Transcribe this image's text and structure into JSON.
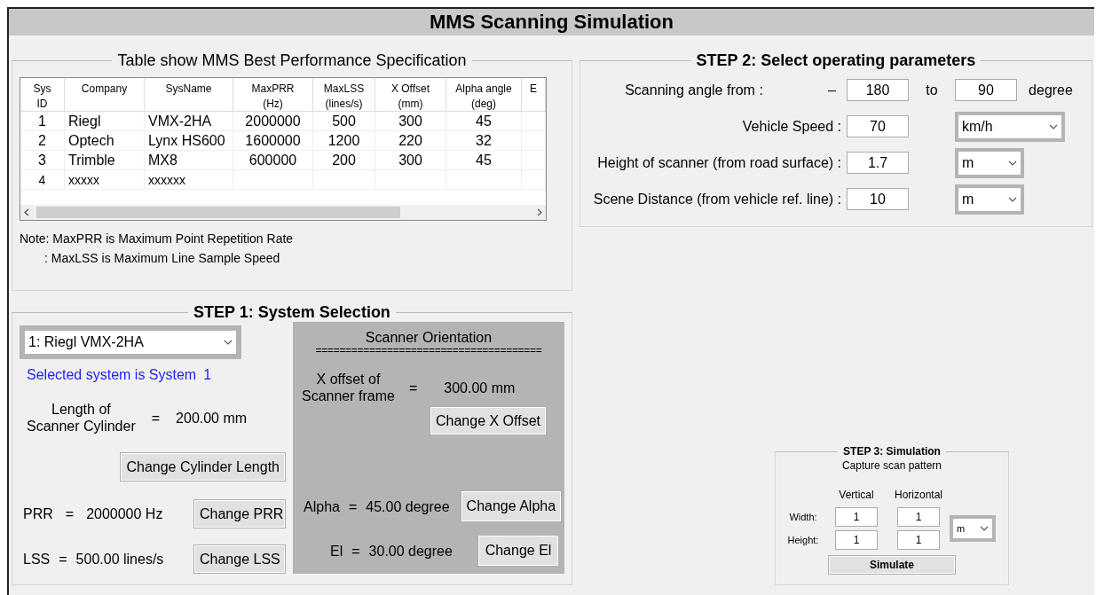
{
  "window": {
    "title": "MMS Scanning Simulation"
  },
  "spec_table": {
    "title": "Table show MMS Best Performance Specification",
    "columns": [
      {
        "label": "Sys",
        "sub": "ID"
      },
      {
        "label": "Company"
      },
      {
        "label": "SysName"
      },
      {
        "label": "MaxPRR",
        "sub": "(Hz)"
      },
      {
        "label": "MaxLSS",
        "sub": "(lines/s)"
      },
      {
        "label": "X Offset",
        "sub": "(mm)"
      },
      {
        "label": "Alpha angle",
        "sub": "(deg)"
      },
      {
        "label": "E"
      }
    ],
    "rows": [
      [
        "1",
        "Riegl",
        "VMX-2HA",
        "2000000",
        "500",
        "300",
        "45"
      ],
      [
        "2",
        "Optech",
        "Lynx HS600",
        "1600000",
        "1200",
        "220",
        "32"
      ],
      [
        "3",
        "Trimble",
        "MX8",
        "600000",
        "200",
        "300",
        "45"
      ],
      [
        "4",
        "xxxxx",
        "xxxxxx",
        "",
        "",
        "",
        ""
      ]
    ],
    "notes": [
      "Note: MaxPRR is Maximum Point Repetition Rate",
      ": MaxLSS is Maximum Line Sample Speed"
    ]
  },
  "step1": {
    "title": "STEP 1: System Selection",
    "system_select": {
      "value": "1: Riegl VMX-2HA"
    },
    "selected_text": "Selected system is System",
    "selected_number": "1",
    "cylinder": {
      "label": "Length of\nScanner Cylinder",
      "equals": "=",
      "value": "200.00 mm",
      "button": "Change Cylinder Length"
    },
    "prr": {
      "label": "PRR",
      "equals": "=",
      "value": "2000000 Hz",
      "button": "Change PRR"
    },
    "lss": {
      "label": "LSS",
      "equals": "=",
      "value": "500.00 lines/s",
      "button": "Change LSS"
    },
    "orientation": {
      "title": "Scanner Orientation",
      "rule": "======================================",
      "x_offset": {
        "label": "X offset of\nScanner frame",
        "equals": "=",
        "value": "300.00 mm",
        "button": "Change X Offset"
      },
      "alpha": {
        "label": "Alpha",
        "equals": "=",
        "value": "45.00 degree",
        "button": "Change Alpha"
      },
      "el": {
        "label": "El",
        "equals": "=",
        "value": "30.00 degree",
        "button": "Change El"
      }
    }
  },
  "step2": {
    "title": "STEP 2: Select operating parameters",
    "angle": {
      "label": "Scanning angle from :",
      "sign": "–",
      "from": "180",
      "to_label": "to",
      "to": "90",
      "unit": "degree"
    },
    "rows": [
      {
        "label": "Vehicle Speed :",
        "value": "70",
        "unit": "km/h",
        "wide": true
      },
      {
        "label": "Height of scanner (from road surface) :",
        "value": "1.7",
        "unit": "m",
        "wide": false
      },
      {
        "label": "Scene Distance (from vehicle ref. line) :",
        "value": "10",
        "unit": "m",
        "wide": false
      }
    ]
  },
  "step3": {
    "title": "STEP 3: Simulation",
    "subtitle": "Capture scan pattern",
    "col_labels": [
      "Vertical",
      "Horizontal"
    ],
    "rows": [
      {
        "label": "Width:",
        "values": [
          "1",
          "1"
        ]
      },
      {
        "label": "Height:",
        "values": [
          "1",
          "1"
        ]
      }
    ],
    "unit": "m",
    "button": "Simulate"
  }
}
